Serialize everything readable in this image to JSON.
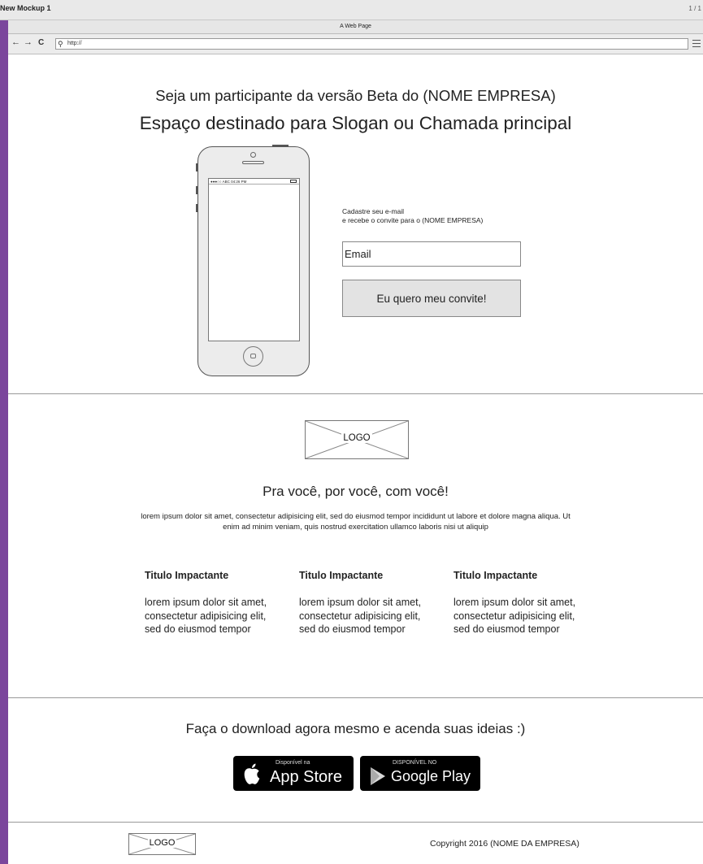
{
  "mockup": {
    "title": "New Mockup 1",
    "pager": "1 / 1"
  },
  "browser": {
    "tab_title": "A Web Page",
    "url": "http://",
    "back": "←",
    "forward": "→",
    "reload": "C"
  },
  "hero": {
    "headline": "Seja um participante da versão Beta do (NOME EMPRESA)",
    "slogan": "Espaço destinado para Slogan ou Chamada principal",
    "phone_status": "●●●○○ ABC    04:26 PM",
    "signup_line1": "Cadastre seu e-mail",
    "signup_line2": "e recebe o convite para o (NOME EMPRESA)",
    "email_placeholder": "Email",
    "cta_label": "Eu quero meu convite!"
  },
  "about": {
    "logo_label": "LOGO",
    "title": "Pra você, por você, com você!",
    "text": "lorem ipsum dolor sit amet, consectetur adipisicing elit, sed do eiusmod tempor incididunt ut labore et dolore magna aliqua. Ut enim ad minim veniam, quis nostrud exercitation ullamco laboris nisi ut aliquip",
    "features": [
      {
        "title": "Titulo Impactante",
        "body": "lorem ipsum dolor sit amet, consectetur adipisicing elit, sed do eiusmod tempor"
      },
      {
        "title": "Titulo Impactante",
        "body": "lorem ipsum dolor sit amet, consectetur adipisicing elit, sed do eiusmod tempor"
      },
      {
        "title": "Titulo Impactante",
        "body": "lorem ipsum dolor sit amet, consectetur adipisicing elit, sed do eiusmod tempor"
      }
    ]
  },
  "download": {
    "title": "Faça o download agora mesmo e acenda suas ideias :)",
    "appstore_small": "Disponível na",
    "appstore_big": "App Store",
    "googleplay_small": "DISPONÍVEL NO",
    "googleplay_big": "Google Play"
  },
  "footer": {
    "logo_label": "LOGO",
    "copyright": "Copyright 2016 (NOME DA EMPRESA)"
  },
  "colors": {
    "frame": "#7b469c",
    "button": "#e3e3e3",
    "store_badge": "#000000"
  }
}
